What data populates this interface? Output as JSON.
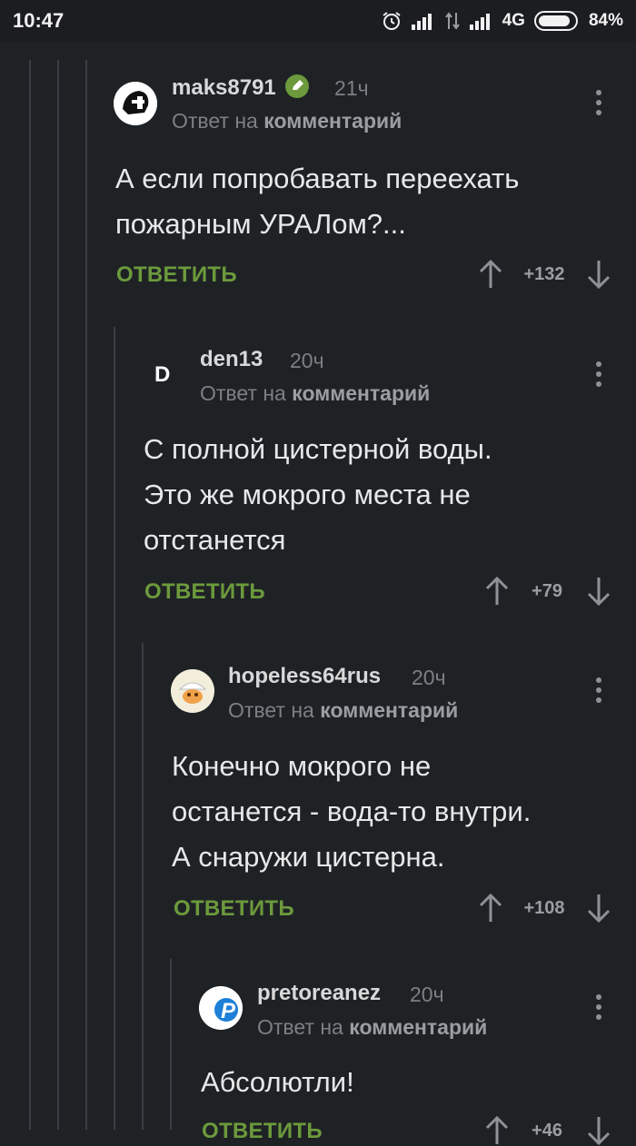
{
  "status_bar": {
    "time": "10:47",
    "network": "4G",
    "battery": "84%"
  },
  "comments": [
    {
      "username": "maks8791",
      "verified": true,
      "time": "21ч",
      "reply_prefix": "Ответ на",
      "reply_target": "комментарий",
      "text": "А если попробавать переехать\nпожарным УРАЛом?...",
      "reply_label": "ОТВЕТИТЬ",
      "score": "+132",
      "avatar_icon": "skull-logo-icon"
    },
    {
      "username": "den13",
      "verified": false,
      "time": "20ч",
      "reply_prefix": "Ответ на",
      "reply_target": "комментарий",
      "text": "С полной цистерной воды.\nЭто же мокрого места не\nотстанется",
      "reply_label": "ОТВЕТИТЬ",
      "score": "+79",
      "avatar_letter": "D"
    },
    {
      "username": "hopeless64rus",
      "verified": false,
      "time": "20ч",
      "reply_prefix": "Ответ на",
      "reply_target": "комментарий",
      "text": "Конечно мокрого не\nостанется - вода-то внутри.\nА снаружи цистерна.",
      "reply_label": "ОТВЕТИТЬ",
      "score": "+108",
      "avatar_icon": "cartoon-face-icon"
    },
    {
      "username": "pretoreanez",
      "verified": false,
      "time": "20ч",
      "reply_prefix": "Ответ на",
      "reply_target": "комментарий",
      "text": "Абсолютли!",
      "reply_label": "ОТВЕТИТЬ",
      "score": "+46",
      "avatar_letter": "P"
    }
  ],
  "colors": {
    "background": "#1f2225",
    "accent_green": "#6c9a3c",
    "muted_text": "#7c7f83"
  }
}
